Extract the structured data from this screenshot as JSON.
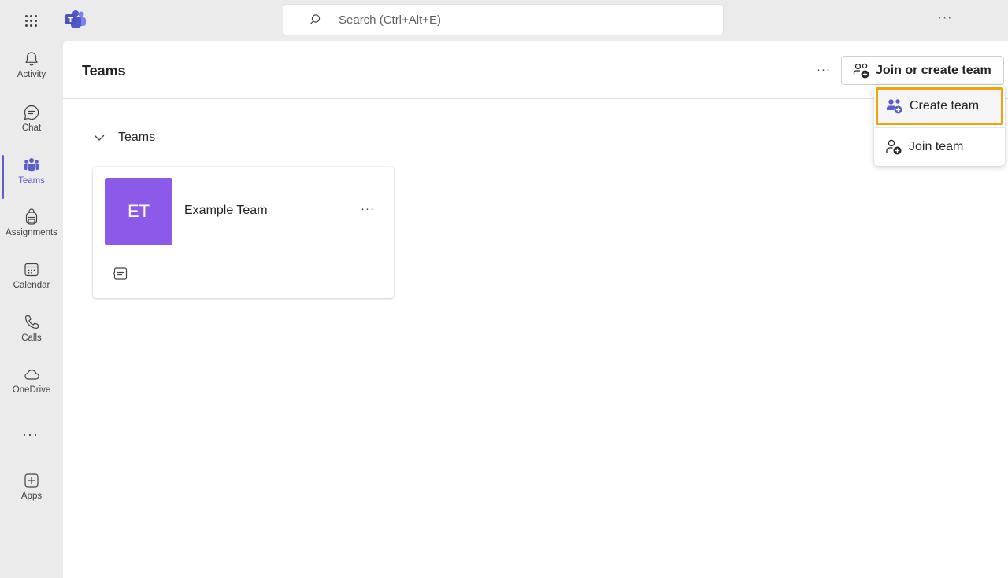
{
  "topbar": {
    "search_placeholder": "Search (Ctrl+Alt+E)",
    "more_label": "···"
  },
  "rail": {
    "items": [
      {
        "label": "Activity",
        "icon": "bell-icon"
      },
      {
        "label": "Chat",
        "icon": "chat-icon"
      },
      {
        "label": "Teams",
        "icon": "teams-icon",
        "active": true
      },
      {
        "label": "Assignments",
        "icon": "backpack-icon"
      },
      {
        "label": "Calendar",
        "icon": "calendar-icon"
      },
      {
        "label": "Calls",
        "icon": "phone-icon"
      },
      {
        "label": "OneDrive",
        "icon": "cloud-icon"
      },
      {
        "label": "Apps",
        "icon": "add-square-icon"
      }
    ],
    "more_label": "···"
  },
  "main": {
    "title": "Teams",
    "more_label": "···",
    "join_create_label": "Join or create team",
    "section_label": "Teams",
    "team_card": {
      "initials": "ET",
      "name": "Example Team",
      "more_label": "···",
      "avatar_color": "#8c5ae8"
    }
  },
  "dropdown": {
    "items": [
      {
        "label": "Create team",
        "icon": "people-add-filled-icon",
        "highlighted": true
      },
      {
        "label": "Join team",
        "icon": "person-add-icon"
      }
    ]
  },
  "colors": {
    "accent": "#5b5fc7",
    "highlight_border": "#f0a30a"
  }
}
